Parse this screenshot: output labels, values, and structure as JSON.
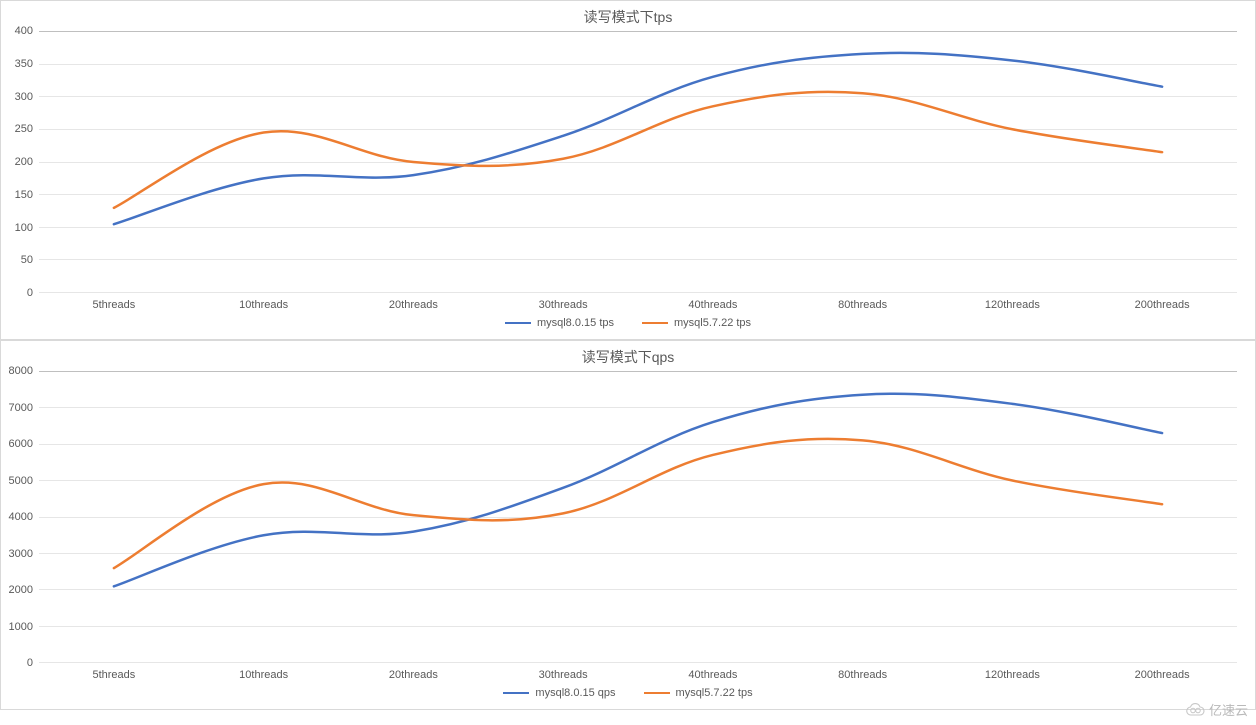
{
  "colors": {
    "series1": "#4472c4",
    "series2": "#ed7d31"
  },
  "watermark": "亿速云",
  "chart_data": [
    {
      "type": "line",
      "title": "读写模式下tps",
      "categories": [
        "5threads",
        "10threads",
        "20threads",
        "30threads",
        "40threads",
        "80threads",
        "120threads",
        "200threads"
      ],
      "xlabel": "",
      "ylabel": "",
      "ylim": [
        0,
        400
      ],
      "yticks": [
        0,
        50,
        100,
        150,
        200,
        250,
        300,
        350,
        400
      ],
      "series": [
        {
          "name": "mysql8.0.15 tps",
          "values": [
            105,
            175,
            180,
            240,
            330,
            365,
            355,
            315
          ]
        },
        {
          "name": "mysql5.7.22 tps",
          "values": [
            130,
            245,
            200,
            205,
            285,
            305,
            250,
            215
          ]
        }
      ]
    },
    {
      "type": "line",
      "title": "读写模式下qps",
      "categories": [
        "5threads",
        "10threads",
        "20threads",
        "30threads",
        "40threads",
        "80threads",
        "120threads",
        "200threads"
      ],
      "xlabel": "",
      "ylabel": "",
      "ylim": [
        0,
        8000
      ],
      "yticks": [
        0,
        1000,
        2000,
        3000,
        4000,
        5000,
        6000,
        7000,
        8000
      ],
      "series": [
        {
          "name": "mysql8.0.15 qps",
          "values": [
            2100,
            3500,
            3600,
            4800,
            6600,
            7350,
            7100,
            6300
          ]
        },
        {
          "name": "mysql5.7.22 tps",
          "values": [
            2600,
            4900,
            4050,
            4100,
            5700,
            6100,
            5000,
            4350
          ]
        }
      ]
    }
  ]
}
